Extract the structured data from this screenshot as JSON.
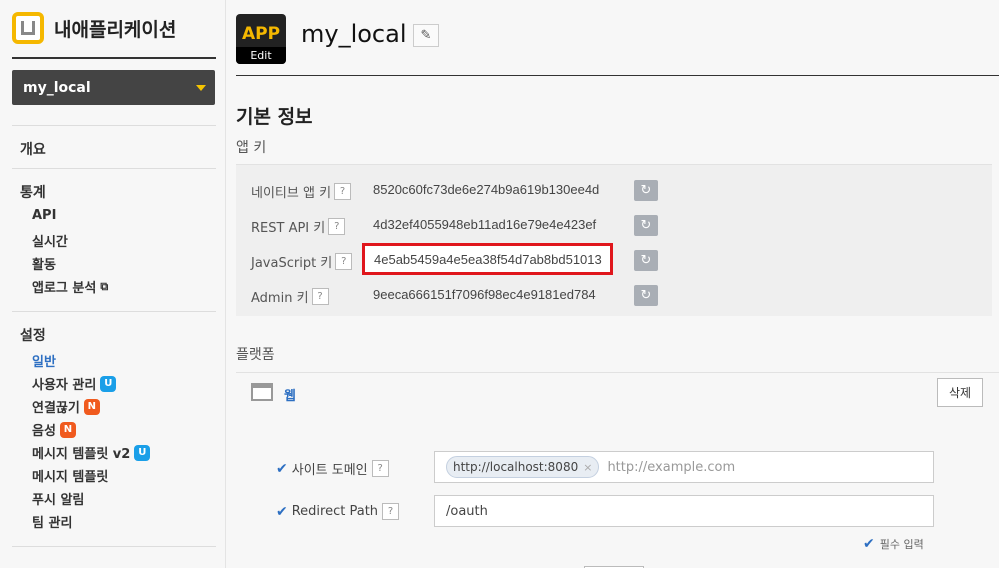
{
  "sidebar": {
    "brand_title": "내애플리케이션",
    "app_select": "my_local",
    "overview": "개요",
    "stats": {
      "heading": "통계",
      "items": [
        "API",
        "실시간",
        "활동",
        "앱로그 분석"
      ]
    },
    "settings": {
      "heading": "설정",
      "items": [
        {
          "label": "일반",
          "badge": ""
        },
        {
          "label": "사용자 관리",
          "badge": "U"
        },
        {
          "label": "연결끊기",
          "badge": "N"
        },
        {
          "label": "음성",
          "badge": "N"
        },
        {
          "label": "메시지 템플릿 v2",
          "badge": "U"
        },
        {
          "label": "메시지 템플릿",
          "badge": ""
        },
        {
          "label": "푸시 알림",
          "badge": ""
        },
        {
          "label": "팀 관리",
          "badge": ""
        }
      ]
    }
  },
  "header": {
    "app_icon_text": "APP",
    "app_icon_edit": "Edit",
    "app_name": "my_local"
  },
  "basic_info": {
    "title": "기본 정보",
    "app_keys_title": "앱 키",
    "keys": [
      {
        "label": "네이티브 앱 키",
        "value": "8520c60fc73de6e274b9a619b130ee4d"
      },
      {
        "label": "REST API 키",
        "value": "4d32ef4055948eb11ad16e79e4e423ef"
      },
      {
        "label": "JavaScript 키",
        "value": "4e5ab5459a4e5ea38f54d7ab8bd51013"
      },
      {
        "label": "Admin 키",
        "value": "9eeca666151f7096f98ec4e9181ed784"
      }
    ],
    "help_glyph": "?"
  },
  "platform": {
    "title": "플랫폼",
    "web_label": "웹",
    "delete_label": "삭제",
    "site_domain_label": "사이트 도메인",
    "site_domain_tag": "http://localhost:8080",
    "site_domain_placeholder": "http://example.com",
    "redirect_label": "Redirect Path",
    "redirect_value": "/oauth",
    "required_note": "필수 입력"
  },
  "colors": {
    "accent_blue": "#2d6fc2",
    "highlight_red": "#e0161c",
    "brand_yellow": "#f5b800"
  }
}
